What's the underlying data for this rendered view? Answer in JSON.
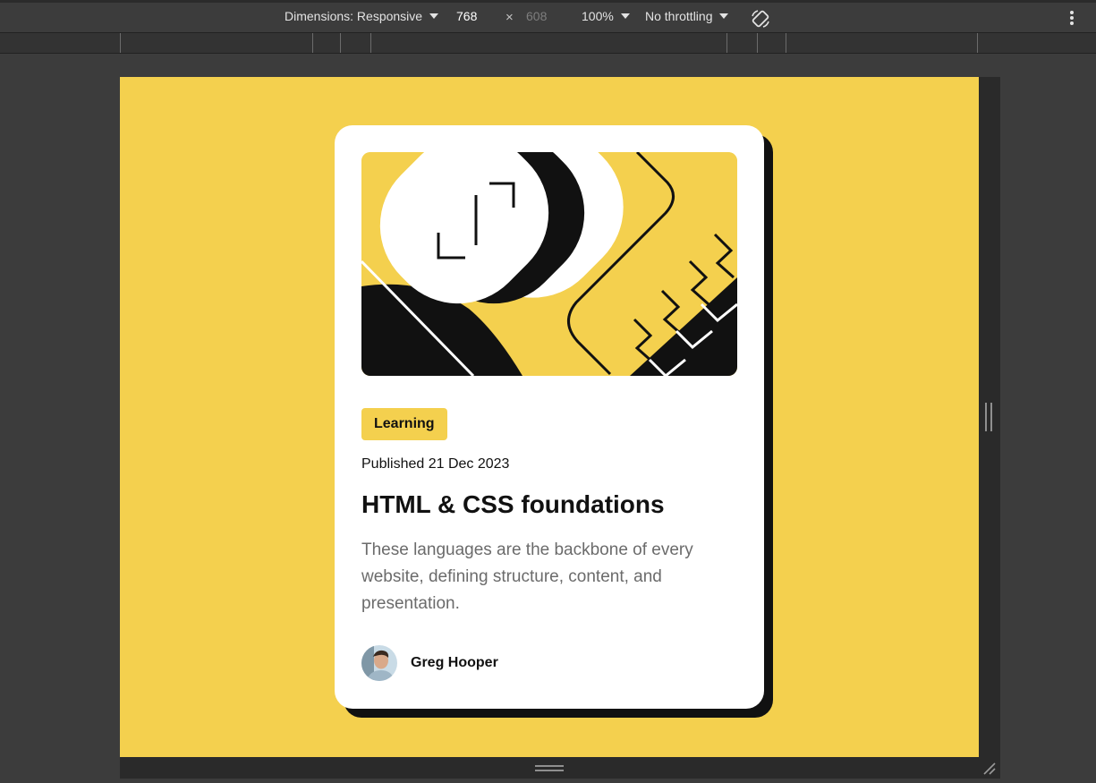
{
  "devtools": {
    "dimensions_label": "Dimensions: Responsive",
    "width": "768",
    "times": "×",
    "height": "608",
    "zoom": "100%",
    "throttling": "No throttling"
  },
  "card": {
    "tag": "Learning",
    "published": "Published 21 Dec 2023",
    "title": "HTML & CSS foundations",
    "description": "These languages are the backbone of every website, defining structure, content, and presentation.",
    "author": "Greg Hooper"
  },
  "colors": {
    "accent": "#f4d04e",
    "ink": "#111111",
    "muted": "#6b6b6b"
  }
}
